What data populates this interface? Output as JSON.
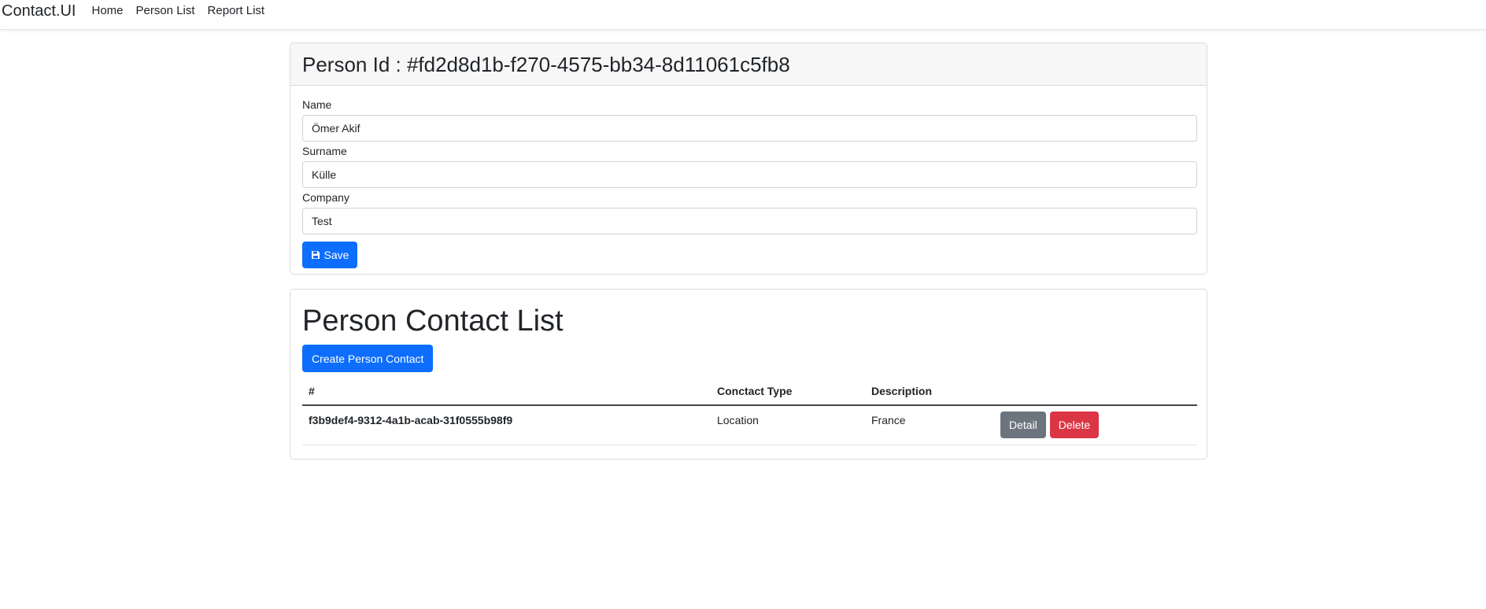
{
  "navbar": {
    "brand": "Contact.UI",
    "links": [
      "Home",
      "Person List",
      "Report List"
    ]
  },
  "person_card": {
    "title": "Person Id : #fd2d8d1b-f270-4575-bb34-8d11061c5fb8",
    "fields": {
      "name": {
        "label": "Name",
        "value": "Ömer Akif"
      },
      "surname": {
        "label": "Surname",
        "value": "Külle"
      },
      "company": {
        "label": "Company",
        "value": "Test"
      }
    },
    "save_label": "Save",
    "save_icon": "floppy-disk-icon"
  },
  "contacts_card": {
    "title": "Person Contact List",
    "create_label": "Create Person Contact",
    "columns": [
      "#",
      "Conctact Type",
      "Description",
      ""
    ],
    "rows": [
      {
        "id": "f3b9def4-9312-4a1b-acab-31f0555b98f9",
        "type": "Location",
        "description": "France",
        "detail_label": "Detail",
        "delete_label": "Delete"
      }
    ]
  },
  "colors": {
    "primary": "#0d6efd",
    "secondary": "#6c757d",
    "danger": "#dc3545",
    "card_header_bg": "#f7f7f7"
  }
}
